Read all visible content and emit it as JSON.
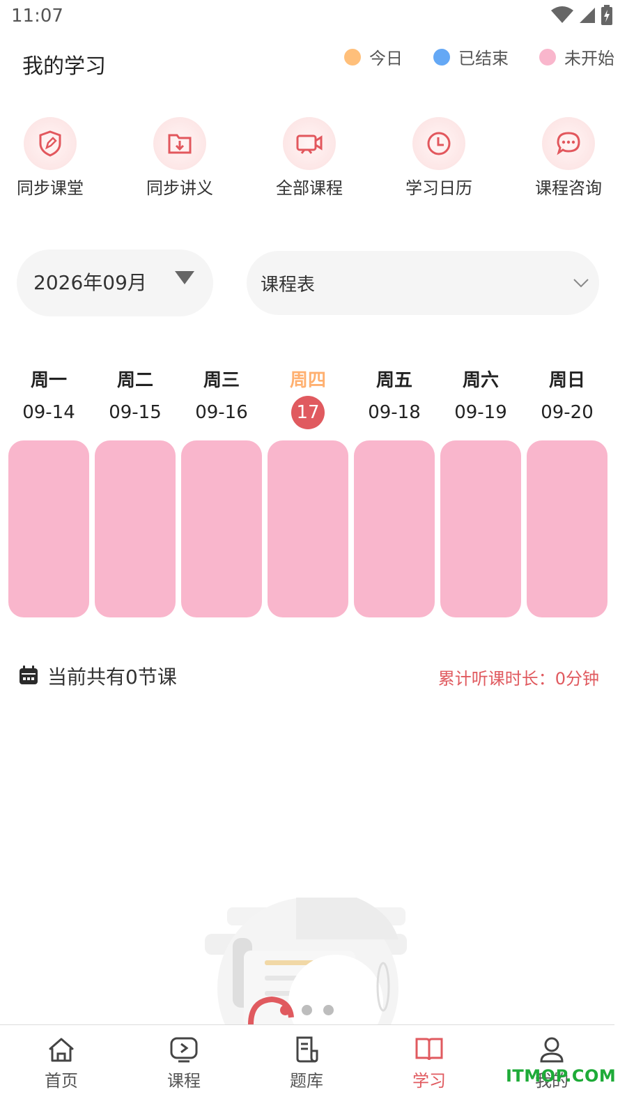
{
  "status_bar": {
    "time": "11:07",
    "icons": [
      "wifi-icon",
      "cell-signal-icon",
      "battery-charging-icon"
    ]
  },
  "header": {
    "title": "我的学习",
    "legend": [
      {
        "label": "今日",
        "color": "#ffbf7a"
      },
      {
        "label": "已结束",
        "color": "#64a8f5"
      },
      {
        "label": "未开始",
        "color": "#f9b6cc"
      }
    ]
  },
  "shortcuts": [
    {
      "label": "同步课堂",
      "icon": "shield-pen-icon"
    },
    {
      "label": "同步讲义",
      "icon": "folder-download-icon"
    },
    {
      "label": "全部课程",
      "icon": "video-camera-icon"
    },
    {
      "label": "学习日历",
      "icon": "clock-icon"
    },
    {
      "label": "课程咨询",
      "icon": "chat-bubble-icon"
    }
  ],
  "filters": {
    "month_value": "2026年09月",
    "view_value": "课程表"
  },
  "week": {
    "days": [
      {
        "name": "周一",
        "date": "09-14",
        "today": false
      },
      {
        "name": "周二",
        "date": "09-15",
        "today": false
      },
      {
        "name": "周三",
        "date": "09-16",
        "today": false
      },
      {
        "name": "周四",
        "date": "17",
        "today": true
      },
      {
        "name": "周五",
        "date": "09-18",
        "today": false
      },
      {
        "name": "周六",
        "date": "09-19",
        "today": false
      },
      {
        "name": "周日",
        "date": "09-20",
        "today": false
      }
    ],
    "card_color": "#f9b6cc",
    "today_color": "#ffb070",
    "accent": "#e05a5f"
  },
  "summary": {
    "lesson_count_text": "当前共有0节课",
    "duration_text": "累计听课时长：0分钟"
  },
  "carousel": {
    "count": 3,
    "active_index": 1
  },
  "bottom_nav": [
    {
      "label": "首页",
      "icon": "home-icon",
      "active": false
    },
    {
      "label": "课程",
      "icon": "play-screen-icon",
      "active": false
    },
    {
      "label": "题库",
      "icon": "document-icon",
      "active": false
    },
    {
      "label": "学习",
      "icon": "open-book-icon",
      "active": true
    },
    {
      "label": "我的",
      "icon": "user-icon",
      "active": false
    }
  ],
  "watermark": "ITMOP.COM"
}
